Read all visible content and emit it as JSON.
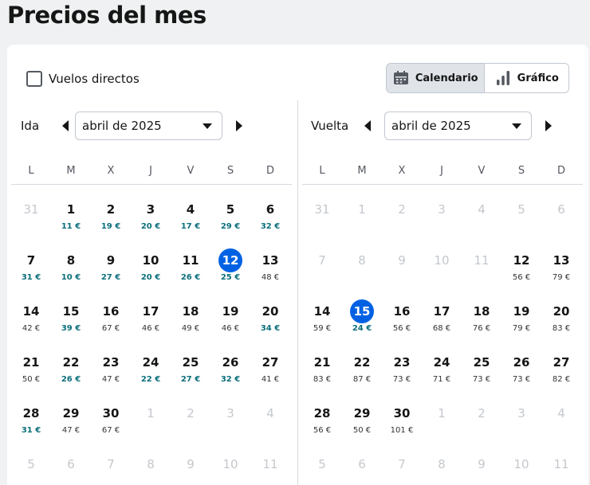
{
  "title": "Precios del mes",
  "direct_flights_label": "Vuelos directos",
  "view_toggle": {
    "calendar_label": "Calendario",
    "chart_label": "Gráfico"
  },
  "colors": {
    "accent": "#0062e3",
    "cheap_price": "#0b6f7b",
    "muted": "#c4c8cd"
  },
  "weekdays": [
    "L",
    "M",
    "X",
    "J",
    "V",
    "S",
    "D"
  ],
  "outbound": {
    "label": "Ida",
    "month": "abril de 2025",
    "weeks": [
      [
        {
          "d": "31",
          "m": true
        },
        {
          "d": "1",
          "p": "11 €",
          "c": true
        },
        {
          "d": "2",
          "p": "19 €",
          "c": true
        },
        {
          "d": "3",
          "p": "20 €",
          "c": true
        },
        {
          "d": "4",
          "p": "17 €",
          "c": true
        },
        {
          "d": "5",
          "p": "29 €",
          "c": true
        },
        {
          "d": "6",
          "p": "32 €",
          "c": true
        }
      ],
      [
        {
          "d": "7",
          "p": "31 €",
          "c": true
        },
        {
          "d": "8",
          "p": "10 €",
          "c": true
        },
        {
          "d": "9",
          "p": "27 €",
          "c": true
        },
        {
          "d": "10",
          "p": "20 €",
          "c": true
        },
        {
          "d": "11",
          "p": "26 €",
          "c": true
        },
        {
          "d": "12",
          "p": "25 €",
          "c": true,
          "s": true
        },
        {
          "d": "13",
          "p": "48 €"
        }
      ],
      [
        {
          "d": "14",
          "p": "42 €"
        },
        {
          "d": "15",
          "p": "39 €",
          "c": true
        },
        {
          "d": "16",
          "p": "67 €"
        },
        {
          "d": "17",
          "p": "46 €"
        },
        {
          "d": "18",
          "p": "49 €"
        },
        {
          "d": "19",
          "p": "46 €"
        },
        {
          "d": "20",
          "p": "34 €",
          "c": true
        }
      ],
      [
        {
          "d": "21",
          "p": "50 €"
        },
        {
          "d": "22",
          "p": "26 €",
          "c": true
        },
        {
          "d": "23",
          "p": "47 €"
        },
        {
          "d": "24",
          "p": "22 €",
          "c": true
        },
        {
          "d": "25",
          "p": "27 €",
          "c": true
        },
        {
          "d": "26",
          "p": "32 €",
          "c": true
        },
        {
          "d": "27",
          "p": "41 €"
        }
      ],
      [
        {
          "d": "28",
          "p": "31 €",
          "c": true
        },
        {
          "d": "29",
          "p": "47 €"
        },
        {
          "d": "30",
          "p": "67 €"
        },
        {
          "d": "1",
          "m": true
        },
        {
          "d": "2",
          "m": true
        },
        {
          "d": "3",
          "m": true
        },
        {
          "d": "4",
          "m": true
        }
      ],
      [
        {
          "d": "5",
          "m": true
        },
        {
          "d": "6",
          "m": true
        },
        {
          "d": "7",
          "m": true
        },
        {
          "d": "8",
          "m": true
        },
        {
          "d": "9",
          "m": true
        },
        {
          "d": "10",
          "m": true
        },
        {
          "d": "11",
          "m": true
        }
      ]
    ]
  },
  "return": {
    "label": "Vuelta",
    "month": "abril de 2025",
    "weeks": [
      [
        {
          "d": "31",
          "m": true
        },
        {
          "d": "1",
          "m": true
        },
        {
          "d": "2",
          "m": true
        },
        {
          "d": "3",
          "m": true
        },
        {
          "d": "4",
          "m": true
        },
        {
          "d": "5",
          "m": true
        },
        {
          "d": "6",
          "m": true
        }
      ],
      [
        {
          "d": "7",
          "m": true
        },
        {
          "d": "8",
          "m": true
        },
        {
          "d": "9",
          "m": true
        },
        {
          "d": "10",
          "m": true
        },
        {
          "d": "11",
          "m": true
        },
        {
          "d": "12",
          "p": "56 €"
        },
        {
          "d": "13",
          "p": "79 €"
        }
      ],
      [
        {
          "d": "14",
          "p": "59 €"
        },
        {
          "d": "15",
          "p": "24 €",
          "c": true,
          "s": true
        },
        {
          "d": "16",
          "p": "56 €"
        },
        {
          "d": "17",
          "p": "68 €"
        },
        {
          "d": "18",
          "p": "76 €"
        },
        {
          "d": "19",
          "p": "79 €"
        },
        {
          "d": "20",
          "p": "83 €"
        }
      ],
      [
        {
          "d": "21",
          "p": "83 €"
        },
        {
          "d": "22",
          "p": "87 €"
        },
        {
          "d": "23",
          "p": "73 €"
        },
        {
          "d": "24",
          "p": "71 €"
        },
        {
          "d": "25",
          "p": "73 €"
        },
        {
          "d": "26",
          "p": "73 €"
        },
        {
          "d": "27",
          "p": "82 €"
        }
      ],
      [
        {
          "d": "28",
          "p": "56 €"
        },
        {
          "d": "29",
          "p": "50 €"
        },
        {
          "d": "30",
          "p": "101 €"
        },
        {
          "d": "1",
          "m": true
        },
        {
          "d": "2",
          "m": true
        },
        {
          "d": "3",
          "m": true
        },
        {
          "d": "4",
          "m": true
        }
      ],
      [
        {
          "d": "5",
          "m": true
        },
        {
          "d": "6",
          "m": true
        },
        {
          "d": "7",
          "m": true
        },
        {
          "d": "8",
          "m": true
        },
        {
          "d": "9",
          "m": true
        },
        {
          "d": "10",
          "m": true
        },
        {
          "d": "11",
          "m": true
        }
      ]
    ]
  }
}
